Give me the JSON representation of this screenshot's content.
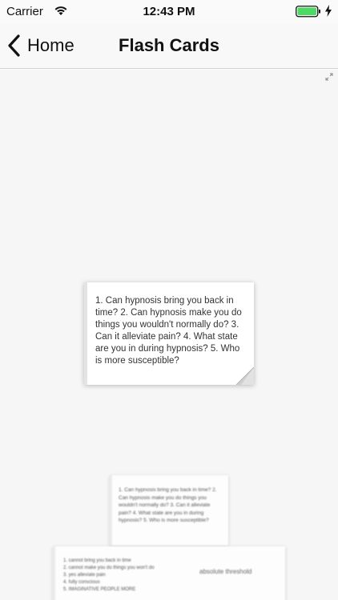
{
  "status_bar": {
    "carrier": "Carrier",
    "time": "12:43 PM",
    "wifi_icon": "wifi-icon",
    "battery_icon": "battery-icon",
    "charging_icon": "bolt-icon",
    "battery_color": "#4cd964"
  },
  "nav": {
    "back_label": "Home",
    "title": "Flash Cards"
  },
  "cards": {
    "front": {
      "text": "1. Can hypnosis bring you back in time? 2. Can hypnosis make you do things you wouldn't normally do? 3. Can it alleviate pain? 4. What state are you in during hypnosis? 5. Who is more susceptible?"
    },
    "stack_1": {
      "text": "1. Can hypnosis bring you back in time? 2. Can hypnosis make you do things you wouldn't normally do? 3. Can it alleviate pain? 4. What state are you in during hypnosis? 5. Who is more susceptible?"
    },
    "stack_2": {
      "notes": [
        "1. cannot bring you back in time",
        "2. cannot make you do things you won't do",
        "3. yes alleviate pain",
        "4. fully conscious",
        "5. IMAGINATIVE PEOPLE MORE"
      ],
      "label": "absolute threshold"
    }
  },
  "colors": {
    "background": "#f6f6f6",
    "card": "#ffffff",
    "text": "#333333"
  }
}
